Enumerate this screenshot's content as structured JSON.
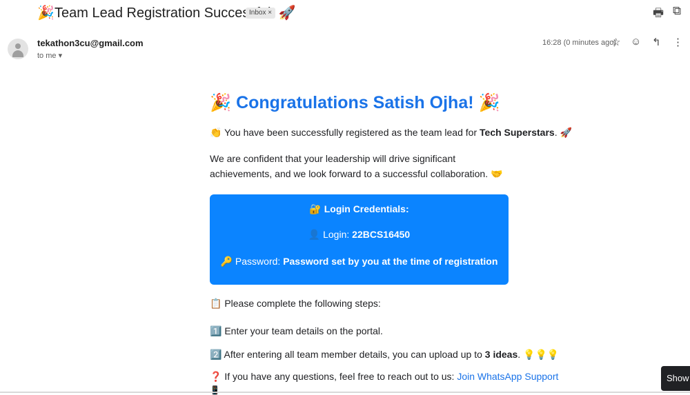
{
  "subject": {
    "emoji": "🎉",
    "text": "Team Lead Registration Successful! 🚀",
    "label_chip": "Inbox",
    "label_close": "×",
    "print_icon": "🖶",
    "open_new_icon": "⧉"
  },
  "header": {
    "sender": "tekathon3cu@gmail.com",
    "to": "to me ▾",
    "time": "16:28 (0 minutes ago)",
    "star_icon": "☆",
    "emoji_icon": "☺",
    "reply_icon": "↰",
    "more_icon": "⋮"
  },
  "body": {
    "heading": "🎉 Congratulations Satish Ojha! 🎉",
    "intro_emoji": "👏",
    "intro_text": " You have been successfully registered as the team lead for ",
    "team_name": "Tech Superstars",
    "intro_end": ". 🚀",
    "confidence_text": "We are confident that your leadership will drive significant achievements, and we look forward to a successful collaboration. 🤝",
    "credentials": {
      "title": "🔐 Login Credentials:",
      "login_icon": "👤",
      "login_label": " Login: ",
      "login_value": "22BCS16450",
      "password_label": "🔑 Password: ",
      "password_value": "Password set by you at the time of registration"
    },
    "steps_intro": "📋 Please complete the following steps:",
    "step1": "1️⃣ Enter your team details on the portal.",
    "step2_text": "2️⃣ After entering all team member details, you can upload up to ",
    "step2_bold": "3 ideas",
    "step2_end": ". 💡💡💡",
    "help_text": "❓ If you have any questions, feel free to reach out to us: ",
    "help_link": "Join WhatsApp Support",
    "phone_icon": "📱"
  },
  "show_button": "Show"
}
